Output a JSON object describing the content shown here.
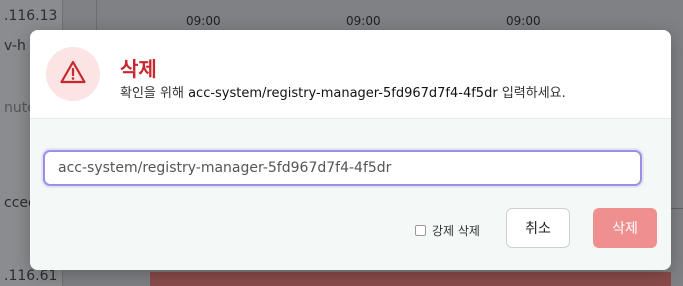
{
  "background": {
    "left_texts": [
      ".116.13",
      "v-h",
      "nute",
      "ccee",
      ".116.61"
    ],
    "times": [
      "09:00",
      "09:00",
      "09:00"
    ]
  },
  "modal": {
    "icon": "warning-triangle-icon",
    "title": "삭제",
    "subtitle_prefix": "확인을 위해",
    "subtitle_target": "acc-system/registry-manager-5fd967d7f4-4f5dr",
    "subtitle_suffix": "입력하세요.",
    "input_value": "acc-system/registry-manager-5fd967d7f4-4f5dr",
    "force_delete_label": "강제 삭제",
    "cancel_label": "취소",
    "delete_label": "삭제"
  },
  "colors": {
    "danger": "#c8282d",
    "danger_soft": "#ef8f8f",
    "focus_border": "#9d8de6"
  }
}
